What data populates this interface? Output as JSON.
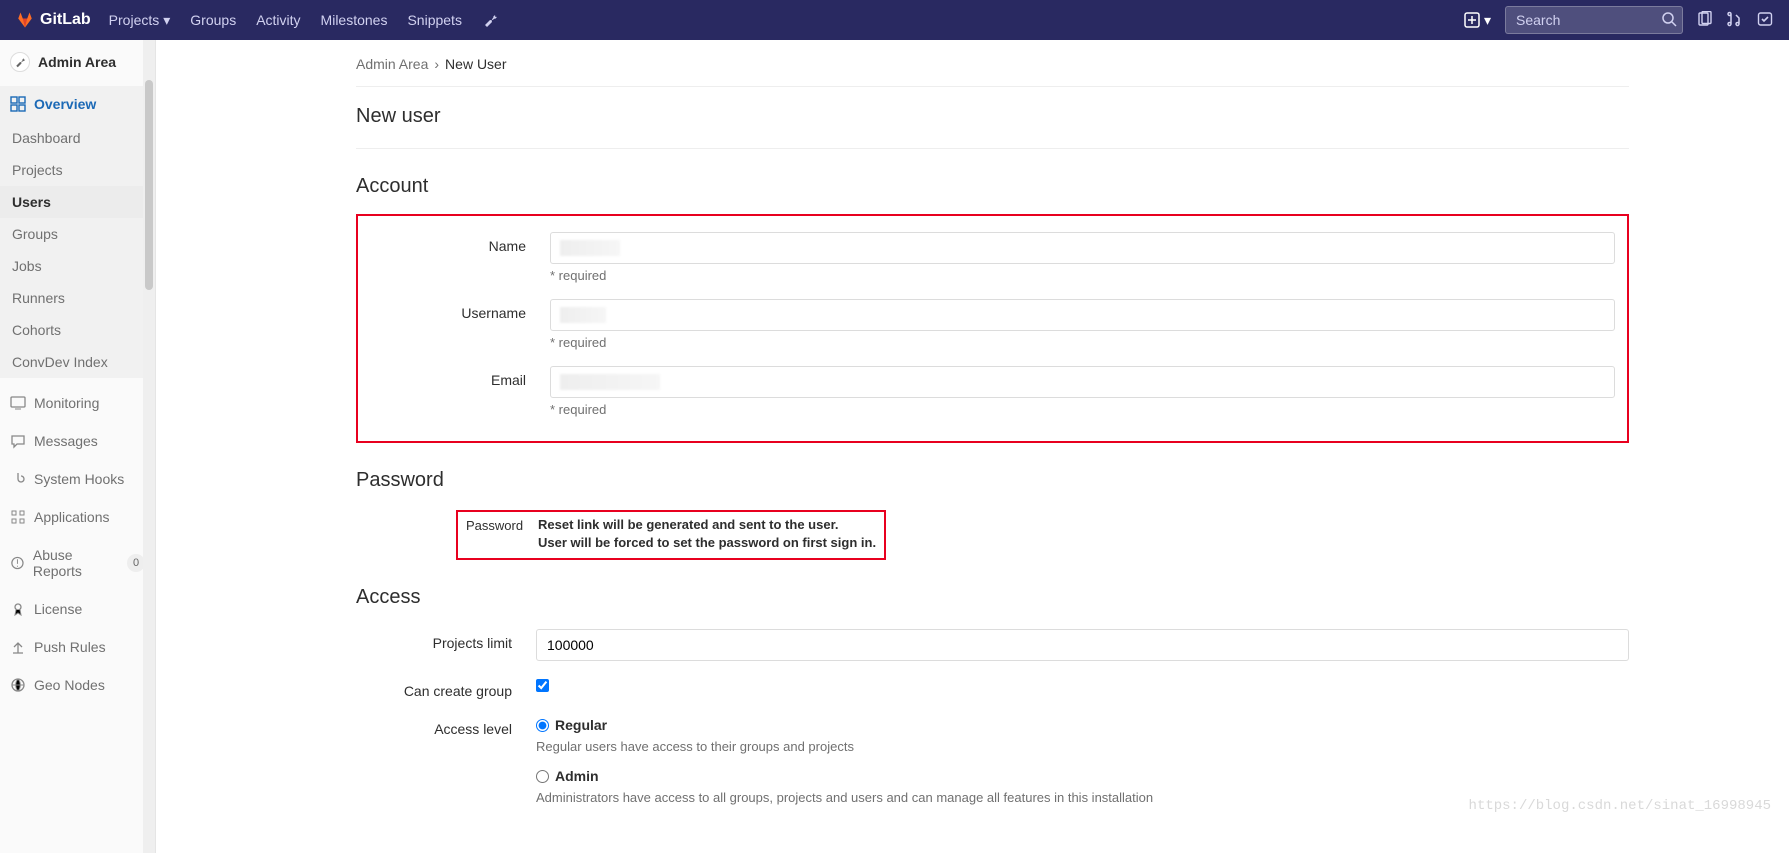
{
  "brand": "GitLab",
  "topnav": {
    "items": [
      "Projects",
      "Groups",
      "Activity",
      "Milestones",
      "Snippets"
    ],
    "search_placeholder": "Search"
  },
  "sidebar": {
    "title": "Admin Area",
    "overview_label": "Overview",
    "overview_items": [
      "Dashboard",
      "Projects",
      "Users",
      "Groups",
      "Jobs",
      "Runners",
      "Cohorts",
      "ConvDev Index"
    ],
    "lower_items": [
      "Monitoring",
      "Messages",
      "System Hooks",
      "Applications",
      "Abuse Reports",
      "License",
      "Push Rules",
      "Geo Nodes"
    ],
    "abuse_badge": "0"
  },
  "breadcrumb": {
    "root": "Admin Area",
    "current": "New User"
  },
  "page_title": "New user",
  "sections": {
    "account": "Account",
    "password": "Password",
    "access": "Access"
  },
  "account": {
    "name_label": "Name",
    "username_label": "Username",
    "email_label": "Email",
    "required": "* required"
  },
  "password": {
    "label": "Password",
    "msg1": "Reset link will be generated and sent to the user.",
    "msg2": "User will be forced to set the password on first sign in."
  },
  "access": {
    "projects_limit_label": "Projects limit",
    "projects_limit_value": "100000",
    "can_create_group_label": "Can create group",
    "can_create_group_checked": true,
    "access_level_label": "Access level",
    "regular_label": "Regular",
    "regular_desc": "Regular users have access to their groups and projects",
    "admin_label": "Admin",
    "admin_desc": "Administrators have access to all groups, projects and users and can manage all features in this installation"
  },
  "watermark": "https://blog.csdn.net/sinat_16998945"
}
